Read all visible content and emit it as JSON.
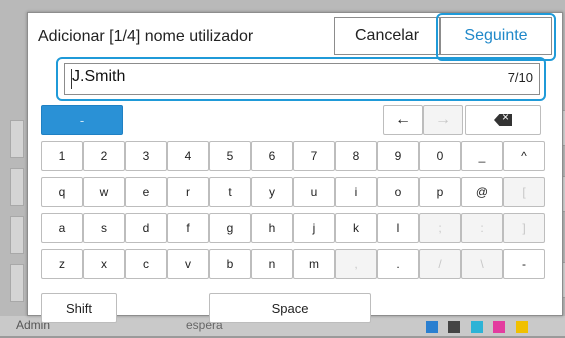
{
  "dialog": {
    "title": "Adicionar [1/4] nome utilizador",
    "cancel_label": "Cancelar",
    "next_label": "Seguinte",
    "input_value": "J.Smith",
    "input_counter": "7/10"
  },
  "keyboard": {
    "mode_label": "-",
    "row1": [
      "1",
      "2",
      "3",
      "4",
      "5",
      "6",
      "7",
      "8",
      "9",
      "0",
      "_",
      "^"
    ],
    "row2": [
      "q",
      "w",
      "e",
      "r",
      "t",
      "y",
      "u",
      "i",
      "o",
      "p",
      "@",
      "["
    ],
    "row3": [
      "a",
      "s",
      "d",
      "f",
      "g",
      "h",
      "j",
      "k",
      "l",
      ";",
      ":",
      "]"
    ],
    "row4": [
      "z",
      "x",
      "c",
      "v",
      "b",
      "n",
      "m",
      ",",
      ".",
      "/",
      "\\",
      "-"
    ],
    "disabled": {
      "row2": [
        11
      ],
      "row3": [
        9,
        10,
        11
      ],
      "row4": [
        7,
        9,
        10
      ]
    },
    "shift_label": "Shift",
    "space_label": "Space",
    "left_arrow": "←",
    "right_arrow": "→"
  },
  "status_bar": {
    "user": "Admin",
    "mode_text": "espera",
    "accent_color": "#1f9ad8"
  }
}
